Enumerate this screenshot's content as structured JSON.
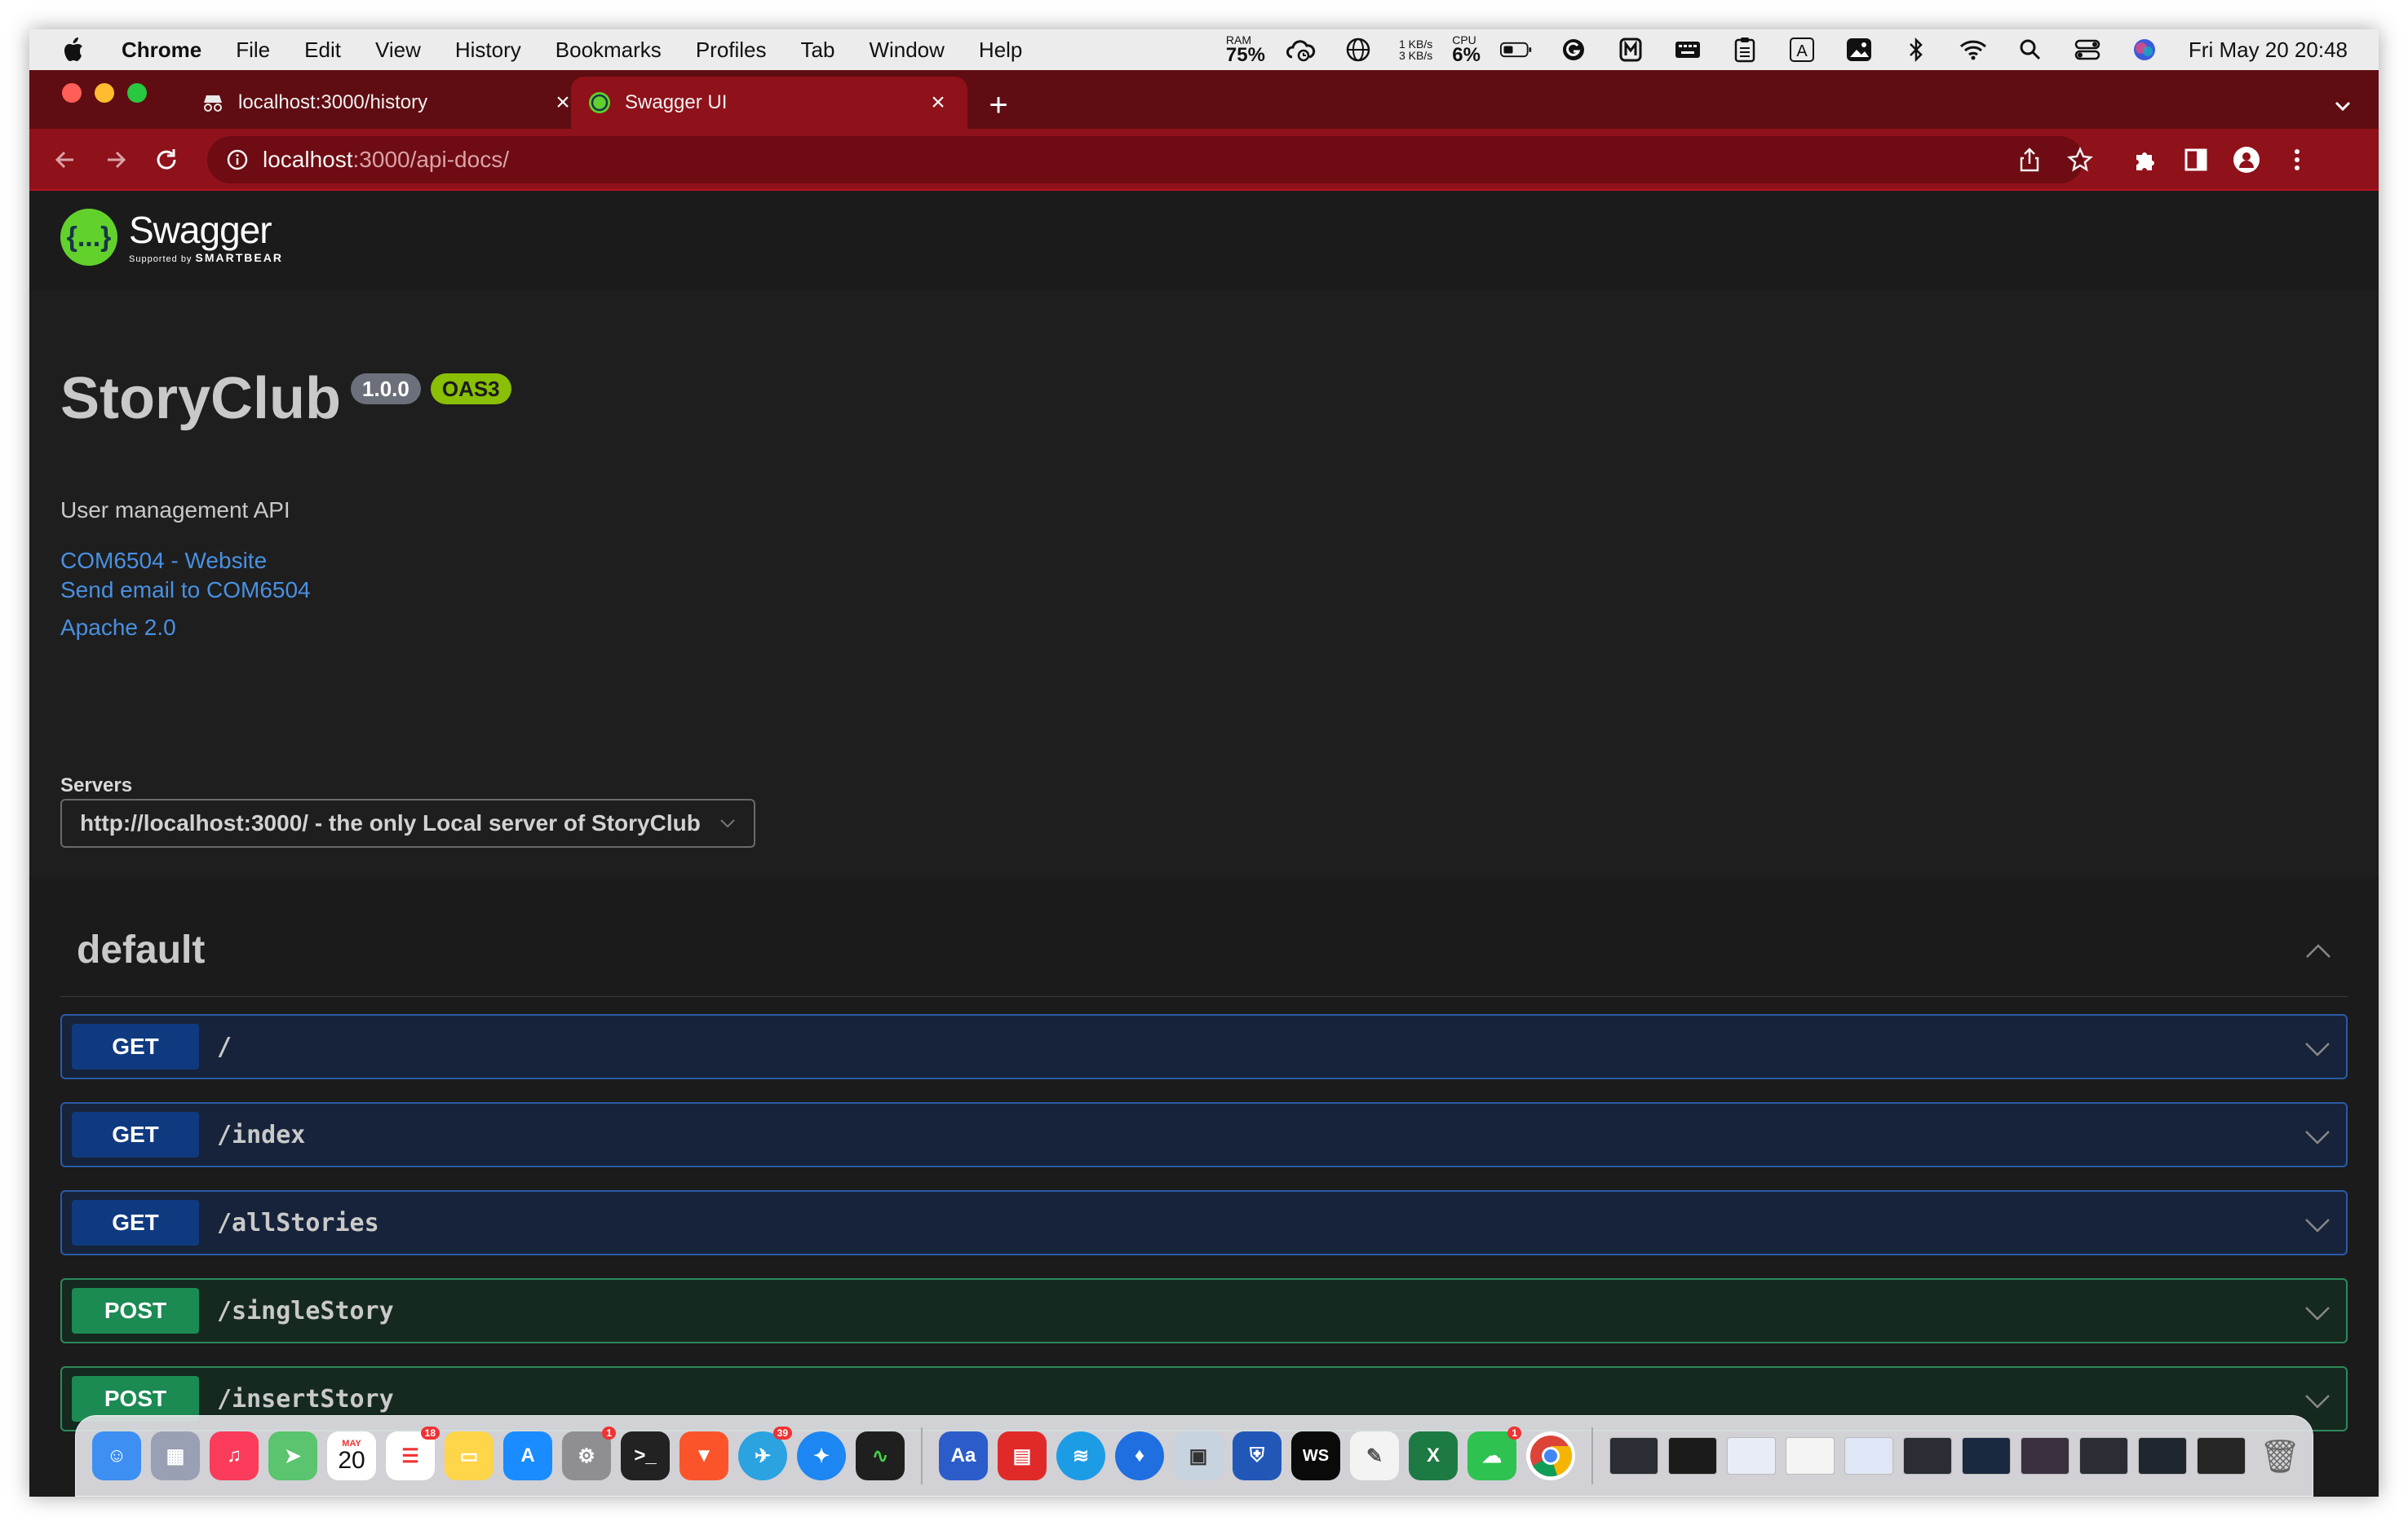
{
  "menubar": {
    "app": "Chrome",
    "items": [
      "File",
      "Edit",
      "View",
      "History",
      "Bookmarks",
      "Profiles",
      "Tab",
      "Window",
      "Help"
    ],
    "ram_label": "RAM",
    "ram_value": "75%",
    "net_up": "1 KB/s",
    "net_down": "3 KB/s",
    "cpu_label": "CPU",
    "cpu_value": "6%",
    "clock": "Fri May 20  20:48"
  },
  "browser": {
    "tabs": [
      {
        "title": "localhost:3000/history",
        "active": false
      },
      {
        "title": "Swagger UI",
        "active": true
      }
    ],
    "url_host": "localhost",
    "url_rest": ":3000/api-docs/"
  },
  "swagger": {
    "logo_name": "Swagger",
    "logo_sub_prefix": "Supported by",
    "logo_sub_brand": "SMARTBEAR",
    "logo_mark": "{...}",
    "title": "StoryClub",
    "version": "1.0.0",
    "oas": "OAS3",
    "description": "User management API",
    "links": [
      "COM6504 - Website",
      "Send email to COM6504",
      "Apache 2.0"
    ],
    "servers_label": "Servers",
    "server_selected": "http://localhost:3000/ - the only Local server of StoryClub",
    "section": "default",
    "operations": [
      {
        "method": "GET",
        "path": "/"
      },
      {
        "method": "GET",
        "path": "/index"
      },
      {
        "method": "GET",
        "path": "/allStories"
      },
      {
        "method": "POST",
        "path": "/singleStory"
      },
      {
        "method": "POST",
        "path": "/insertStory"
      }
    ]
  },
  "dock": {
    "calendar_month": "MAY",
    "calendar_day": "20",
    "badges": [
      "18",
      "1",
      "39",
      "1"
    ]
  },
  "colors": {
    "tabstrip": "#5f0d12",
    "toolbar": "#8f111a",
    "get": "#0f3a80",
    "post": "#1b8a53",
    "link": "#4990e2",
    "swagger_green": "#62d12c"
  }
}
